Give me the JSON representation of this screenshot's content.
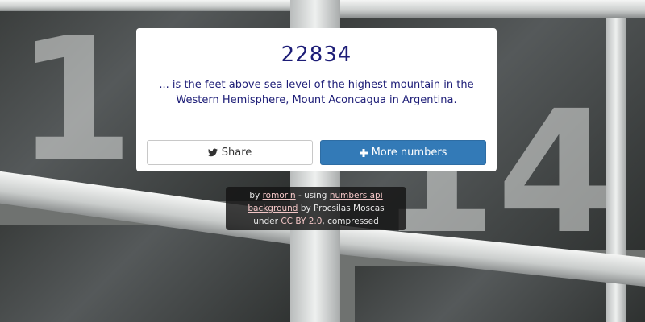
{
  "fact": {
    "number": "22834",
    "text": "... is the feet above sea level of the highest mountain in the Western Hemisphere, Mount Aconcagua in Argentina."
  },
  "buttons": {
    "share_label": "Share",
    "more_label": "More numbers"
  },
  "credits": {
    "by_prefix": "by",
    "author_link": "romorin",
    "using_text": "- using",
    "api_link": "numbers api",
    "background_link": "background",
    "background_by": "by Procsilas Moscas",
    "under_text": "under",
    "license_link": "CC BY 2.0",
    "compressed_text": ", compressed"
  },
  "background": {
    "numbers": [
      "13",
      "14"
    ]
  },
  "colors": {
    "accent": "#337ab7",
    "number_text": "#1d1d77",
    "credits_link": "#f3c6c6"
  },
  "icons": {
    "share": "twitter-bird-icon",
    "more": "plus-icon"
  }
}
